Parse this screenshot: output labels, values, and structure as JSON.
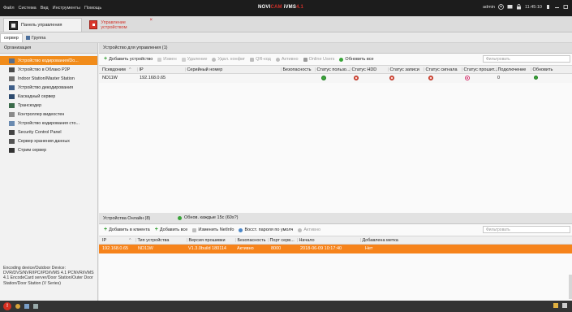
{
  "menubar": {
    "items": [
      "Файл",
      "Система",
      "Вид",
      "Инструменты",
      "Помощь"
    ],
    "brand_a": "NOVI",
    "brand_b": "CAM",
    "brand_c": " iVMS",
    "brand_d": "4.1",
    "user": "admin",
    "time": "11:45:10"
  },
  "tabs": {
    "control_panel": "Панель управления",
    "device_mgmt": "Управление устройством",
    "close_glyph": "×"
  },
  "subtabs": {
    "server": "сервер",
    "group": "Группа"
  },
  "left": {
    "header": "Организация",
    "items": [
      "Устройство кодирования/Do...",
      "Устройство в Облако P2P",
      "Indoor Station/Master Station",
      "Устройство декодирования",
      "Каскадный сервер",
      "Транскодер",
      "Контроллер видеостен",
      "Устройство кодирования сто...",
      "Security Control Panel",
      "Сервер хранения данных",
      "Стрим сервер"
    ],
    "description": "Encoding device/Outdoor Device: DVR/DVS/NVR/IPC/IPD/iVMS 4.1 PCNVR/iVMS 4.1 EncodeCard server/Door Station/Outer Door Station/Door Station (V Series)"
  },
  "managed": {
    "title": "Устройство для управления (1)",
    "toolbar": {
      "add": "Добавить устройство",
      "edit": "Измен",
      "delete": "Удаление",
      "remote_config": "Удал. конфиг",
      "qr": "QR-код",
      "activate": "Активно",
      "online_users": "Online Users",
      "refresh": "Обновить все"
    },
    "filter_placeholder": "Фильтровать",
    "columns": [
      "Псевдоним",
      "IP",
      "Серийный номер",
      "Безопасность",
      "Статус пользо...",
      "Статус HDD",
      "Статус записи",
      "Статус сигнала",
      "Статус прошит...",
      "Подключение",
      "Обновить"
    ],
    "rows": [
      {
        "alias": "ND11W",
        "ip": "192.168.0.65",
        "serial": "",
        "security": "",
        "connection": "0"
      }
    ]
  },
  "online": {
    "title": "Устройства Онлайн (8)",
    "refresh_note": "Обнов. каждые 15с (60s?)",
    "toolbar": {
      "add_client": "Добавить в клиента",
      "add_all": "Добавить все",
      "netinfo": "Изменить NetInfo",
      "reset_pwd": "Восст. пароля по умолч",
      "activate": "Активно"
    },
    "filter_placeholder": "Фильтровать",
    "columns": [
      "IP",
      "Тип устройства",
      "Версия прошивки",
      "Безопасность",
      "Порт серв...",
      "Начало",
      "Добавлена метка"
    ],
    "rows": [
      {
        "ip": "192.168.0.65",
        "type": "ND11W",
        "firmware": "V1.3.0build 180114",
        "security": "Активно",
        "port": "8000",
        "start": "2018-06-09 10:17:40",
        "added": "Нет"
      }
    ]
  },
  "status": {
    "warn_glyph": "!"
  },
  "colors": {
    "accent": "#f6831b",
    "menubar": "#1c1c1c",
    "brand_red": "#d0302a"
  }
}
